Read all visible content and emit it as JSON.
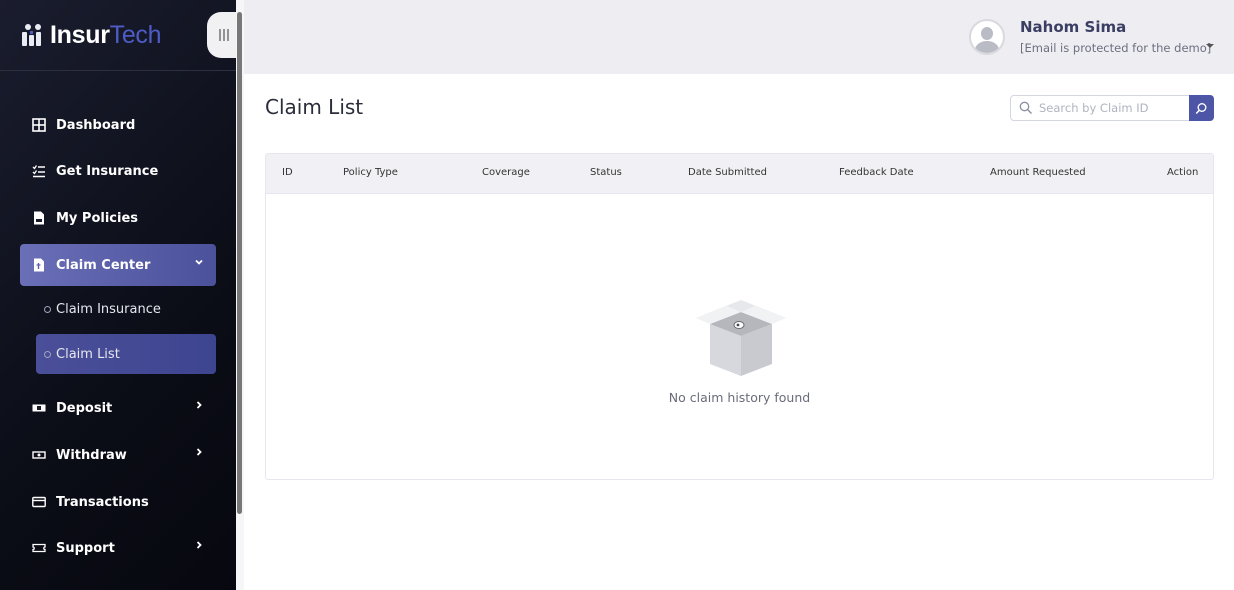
{
  "brand": {
    "part1": "Insur",
    "part2": "Tech"
  },
  "sidebar": {
    "items": [
      {
        "label": "Dashboard",
        "icon": "grid-icon"
      },
      {
        "label": "Get Insurance",
        "icon": "list-check-icon"
      },
      {
        "label": "My Policies",
        "icon": "document-icon"
      },
      {
        "label": "Claim Center",
        "icon": "claim-document-icon",
        "expanded": true
      },
      {
        "label": "Deposit",
        "icon": "money-icon"
      },
      {
        "label": "Withdraw",
        "icon": "cash-icon"
      },
      {
        "label": "Transactions",
        "icon": "card-icon"
      },
      {
        "label": "Support",
        "icon": "ticket-icon"
      }
    ],
    "sub_items": [
      {
        "label": "Claim Insurance"
      },
      {
        "label": "Claim List",
        "active": true
      }
    ]
  },
  "user": {
    "name": "Nahom Sima",
    "email": "[Email is protected for the demo]"
  },
  "page": {
    "title": "Claim List",
    "search_placeholder": "Search by Claim ID"
  },
  "table": {
    "columns": [
      "ID",
      "Policy Type",
      "Coverage",
      "Status",
      "Date Submitted",
      "Feedback Date",
      "Amount Requested",
      "Action"
    ],
    "rows": [],
    "empty_message": "No claim history found"
  },
  "colors": {
    "accent": "#4c55a6",
    "sidebar_bg": "#0b0d17",
    "active_item": "#5a5fa8"
  }
}
